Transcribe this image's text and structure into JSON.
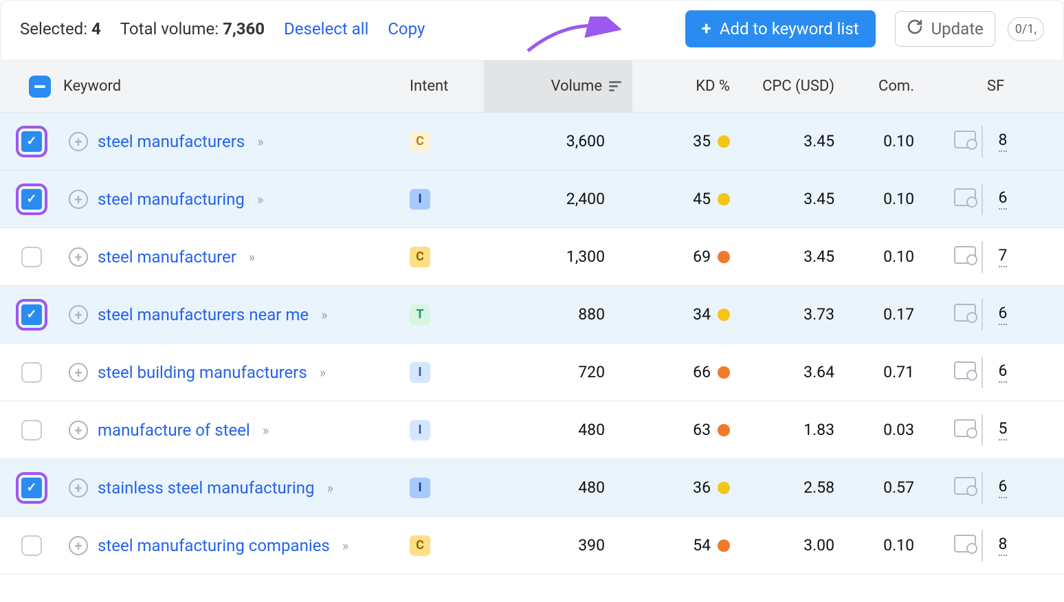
{
  "toolbar": {
    "selected_label": "Selected:",
    "selected_count": "4",
    "total_volume_label": "Total volume:",
    "total_volume": "7,360",
    "deselect": "Deselect all",
    "copy": "Copy",
    "add_button": "Add to keyword list",
    "update": "Update",
    "update_counter": "0/1,"
  },
  "headers": {
    "keyword": "Keyword",
    "intent": "Intent",
    "volume": "Volume",
    "kd": "KD %",
    "cpc": "CPC (USD)",
    "com": "Com.",
    "sf": "SF"
  },
  "rows": [
    {
      "checked": true,
      "highlight": true,
      "keyword": "steel manufacturers",
      "intent": "C",
      "intent_style": "C-light",
      "volume": "3,600",
      "kd": "35",
      "kd_color": "yellow",
      "cpc": "3.45",
      "com": "0.10",
      "sf": "8"
    },
    {
      "checked": true,
      "highlight": true,
      "keyword": "steel manufacturing",
      "intent": "I",
      "intent_style": "I-strong",
      "volume": "2,400",
      "kd": "45",
      "kd_color": "yellow",
      "cpc": "3.45",
      "com": "0.10",
      "sf": "6"
    },
    {
      "checked": false,
      "highlight": false,
      "keyword": "steel manufacturer",
      "intent": "C",
      "intent_style": "C-strong",
      "volume": "1,300",
      "kd": "69",
      "kd_color": "orange",
      "cpc": "3.45",
      "com": "0.10",
      "sf": "7"
    },
    {
      "checked": true,
      "highlight": true,
      "keyword": "steel manufacturers near me",
      "intent": "T",
      "intent_style": "T",
      "volume": "880",
      "kd": "34",
      "kd_color": "yellow",
      "cpc": "3.73",
      "com": "0.17",
      "sf": "6"
    },
    {
      "checked": false,
      "highlight": false,
      "keyword": "steel building manufacturers",
      "intent": "I",
      "intent_style": "I-light",
      "volume": "720",
      "kd": "66",
      "kd_color": "orange",
      "cpc": "3.64",
      "com": "0.71",
      "sf": "6"
    },
    {
      "checked": false,
      "highlight": false,
      "keyword": "manufacture of steel",
      "intent": "I",
      "intent_style": "I-light",
      "volume": "480",
      "kd": "63",
      "kd_color": "orange",
      "cpc": "1.83",
      "com": "0.03",
      "sf": "5"
    },
    {
      "checked": true,
      "highlight": true,
      "keyword": "stainless steel manufacturing",
      "intent": "I",
      "intent_style": "I-strong",
      "volume": "480",
      "kd": "36",
      "kd_color": "yellow",
      "cpc": "2.58",
      "com": "0.57",
      "sf": "6"
    },
    {
      "checked": false,
      "highlight": false,
      "keyword": "steel manufacturing companies",
      "intent": "C",
      "intent_style": "C-strong",
      "volume": "390",
      "kd": "54",
      "kd_color": "orange",
      "cpc": "3.00",
      "com": "0.10",
      "sf": "8"
    }
  ]
}
